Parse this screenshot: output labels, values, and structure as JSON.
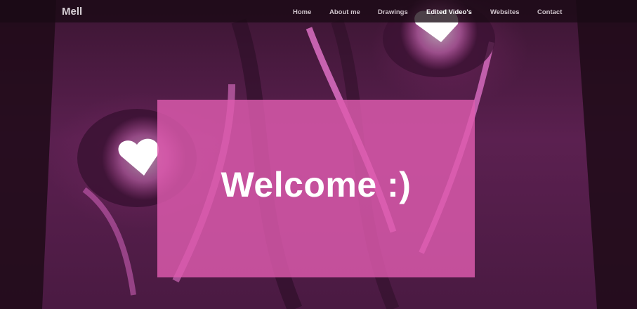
{
  "brand": {
    "name": "Mell"
  },
  "nav": {
    "items": [
      {
        "label": "Home"
      },
      {
        "label": "About me"
      },
      {
        "label": "Drawings"
      },
      {
        "label": "Edited Video's",
        "active": true
      },
      {
        "label": "Websites"
      },
      {
        "label": "Contact"
      }
    ]
  },
  "hero": {
    "background_description_icon": "anime-eyes-heart-image",
    "welcome_text": "Welcome :)"
  },
  "colors": {
    "navbar_bg": "#190a14",
    "panel_bg": "#de5caf",
    "text": "#ffffff",
    "accent_glow": "#ff6ad8"
  }
}
